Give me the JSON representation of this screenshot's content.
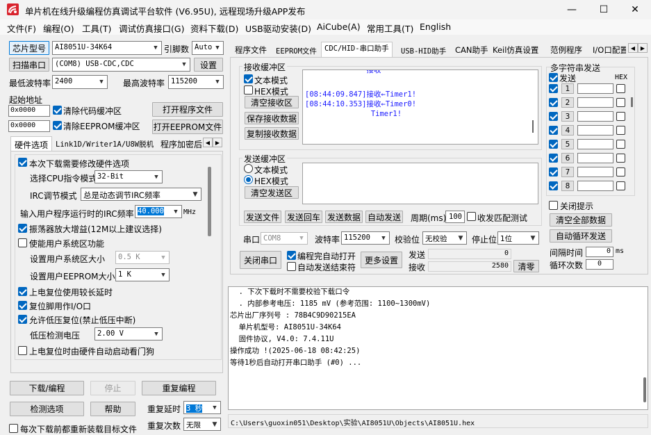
{
  "window": {
    "title": "单片机在线升级编程仿真调试平台软件 (V6.95U), 远程现场升级APP发布",
    "minimize": "—",
    "maximize": "☐",
    "close": "✕"
  },
  "menu": [
    "文件(F)",
    "编程(O)",
    "工具(T)",
    "调试仿真接口(G)",
    "资料下载(D)",
    "USB驱动安装(D)",
    "AiCube(A)",
    "常用工具(T)",
    "English"
  ],
  "left": {
    "chip_button": "芯片型号",
    "chip_value": "AI8051U-34K64",
    "pin_label": "引脚数",
    "pin_value": "Auto",
    "scan_button": "扫描串口",
    "port_value": "(COM8) USB-CDC,CDC",
    "settings_button": "设置",
    "min_baud_label": "最低波特率",
    "min_baud": "2400",
    "max_baud_label": "最高波特率",
    "max_baud": "115200",
    "start_addr_label": "起始地址",
    "addr1": "0x0000",
    "clear_code_label": "清除代码缓冲区",
    "open_prog_button": "打开程序文件",
    "addr2": "0x0000",
    "clear_eeprom_label": "清除EEPROM缓冲区",
    "open_eeprom_button": "打开EEPROM文件",
    "subtabs": [
      "硬件选项",
      "Link1D/Writer1A/U8W脱机",
      "程序加密后"
    ]
  },
  "hw": {
    "modify_label": "本次下载需要修改硬件选项",
    "cpu_label": "选择CPU指令模式",
    "cpu_value": "32-Bit",
    "irc_mode_label": "IRC调节模式",
    "irc_mode_value": "总是动态调节IRC频率",
    "irc_freq_label": "输入用户程序运行时的IRC频率",
    "irc_freq_value": "40.000",
    "irc_unit": "MHz",
    "osc_gain_label": "振荡器放大增益(12M以上建议选择)",
    "user_sys_label": "使能用户系统区功能",
    "user_sys_size_label": "设置用户系统区大小",
    "user_sys_size_value": "0.5 K",
    "user_eeprom_label": "设置用户EEPROM大小",
    "user_eeprom_value": "1   K",
    "long_delay_label": "上电复位使用较长延时",
    "reset_io_label": "复位脚用作I/O口",
    "lvd_reset_label": "允许低压复位(禁止低压中断)",
    "lvd_volt_label": "低压检测电压",
    "lvd_volt_value": "2.00 V",
    "watchdog_label": "上电复位时由硬件自动启动看门狗"
  },
  "bottom_left": {
    "download_button": "下载/编程",
    "stop_button": "停止",
    "reprogram_button": "重复编程",
    "detect_button": "检测选项",
    "help_button": "帮助",
    "repeat_delay_label": "重复延时",
    "repeat_delay_value": "3 秒",
    "reload_label": "每次下载前都重新装载目标文件",
    "repeat_count_label": "重复次数",
    "repeat_count_value": "无限"
  },
  "tabs": [
    "程序文件",
    "EEPROM文件",
    "CDC/HID-串口助手",
    "USB-HID助手",
    "CAN助手",
    "Keil仿真设置",
    "范例程序",
    "I/O口配置"
  ],
  "serial": {
    "rx_title": "接收缓冲区",
    "rx_text_mode": "文本模式",
    "rx_hex_mode": "HEX模式",
    "clear_rx_button": "清空接收区",
    "save_rx_button": "保存接收数据",
    "copy_rx_button": "复制接收数据",
    "rx_lines": [
      "[08:44:09.847]接收←Timer1!",
      "",
      "[08:44:10.353]接收←Timer0!",
      "               Timer1!"
    ],
    "rx_partial": "              接收",
    "tx_title": "发送缓冲区",
    "tx_text_mode": "文本模式",
    "tx_hex_mode": "HEX模式",
    "clear_tx_button": "清空发送区",
    "send_file_button": "发送文件",
    "send_return_button": "发送回车",
    "send_data_button": "发送数据",
    "auto_send_button": "自动发送",
    "period_label": "周期(ms)",
    "period_value": "100",
    "match_label": "收发匹配测试",
    "port_label": "串口",
    "port_value": "COM8",
    "baud_label": "波特率",
    "baud_value": "115200",
    "parity_label": "校验位",
    "parity_value": "无校验",
    "stop_label": "停止位",
    "stop_value": "1位",
    "close_port_button": "关闭串口",
    "auto_open_label": "编程完自动打开",
    "auto_end_label": "自动发送结束符",
    "more_button": "更多设置",
    "tx_count_label": "发送",
    "tx_count": "0",
    "rx_count_label": "接收",
    "rx_count": "2580",
    "zero_button": "清零"
  },
  "multi": {
    "title": "多字符串发送",
    "send_label": "发送",
    "hex_label": "HEX",
    "rows": [
      "1",
      "2",
      "3",
      "4",
      "5",
      "6",
      "7",
      "8"
    ],
    "close_tip_label": "关闭提示",
    "clear_all_button": "清空全部数据",
    "auto_loop_button": "自动循环发送",
    "interval_label": "间隔时间",
    "interval_value": "0",
    "interval_unit": "ms",
    "loop_label": "循环次数",
    "loop_value": "0"
  },
  "log": {
    "lines": [
      "  . 下次下载时不需要校验下载口令",
      "  . 内部参考电压: 1185 mV (参考范围: 1100~1300mV)",
      "芯片出厂序列号 : 78B4C9D90215EA",
      "",
      "  单片机型号: AI8051U-34K64",
      "  固件协议, V4.0: 7.4.11U",
      "",
      "操作成功 !(2025-06-18 08:42:25)",
      "",
      "等待1秒后自动打开串口助手 (#0) ..."
    ],
    "path": "C:\\Users\\guoxin051\\Desktop\\实验\\AI8051U\\Objects\\AI8051U.hex"
  }
}
